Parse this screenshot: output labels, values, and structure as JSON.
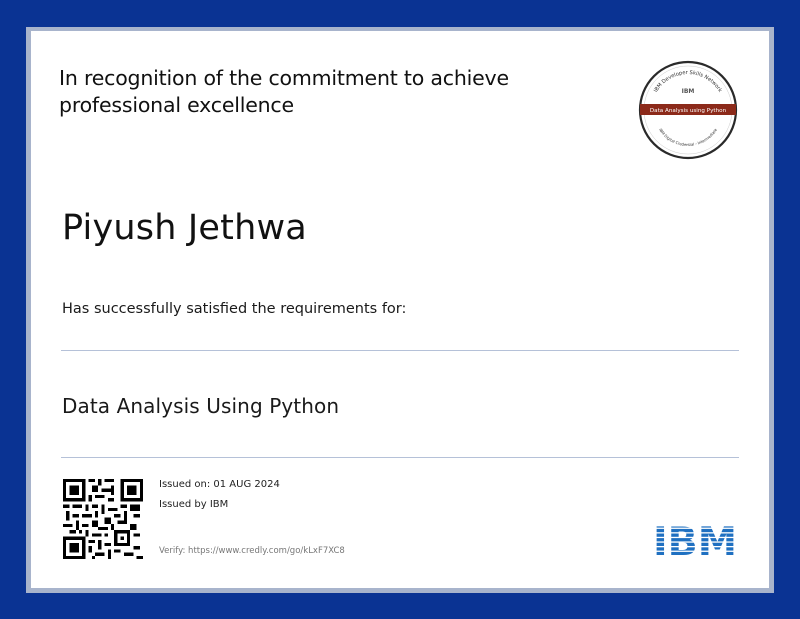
{
  "certificate": {
    "recognition_text": "In recognition of the commitment to achieve professional excellence",
    "recipient_name": "Piyush Jethwa",
    "requirements_text": "Has successfully satisfied the requirements for:",
    "course_title": "Data Analysis Using Python",
    "issued_on": "Issued on: 01 AUG 2024",
    "issued_by": "Issued by IBM",
    "verify_text": "Verify: https://www.credly.com/go/kLxF7XC8"
  },
  "badge": {
    "network_text": "IBM Developer Skills Network",
    "logo_text": "IBM",
    "ribbon_text": "Data Analysis using Python",
    "bottom_text": "IBM Digital Credential - Intermediate",
    "ribbon_color": "#8c2a1a"
  },
  "brand": {
    "logo_text": "IBM",
    "logo_color": "#1f70c1",
    "border_color": "#0a3393"
  },
  "icons": {
    "qr": "qr-code-icon",
    "badge": "credential-badge-icon",
    "logo": "ibm-logo-icon"
  }
}
